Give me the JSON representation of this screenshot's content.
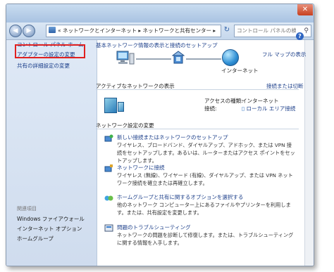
{
  "address": {
    "back_glyph": "◀",
    "forward_glyph": "▶",
    "icon": "control-panel-icon",
    "breadcrumb": "«  ネットワークとインターネット  ▸  ネットワークと共有センター  ▸",
    "refresh_glyph": "↻"
  },
  "search": {
    "placeholder": "コントロール パネルの検索",
    "icon_glyph": "⚲"
  },
  "window": {
    "close_glyph": "✕"
  },
  "sidebar": {
    "home": "コントロール パネル ホーム",
    "adapter_settings": "アダプターの設定の変更",
    "advanced_sharing": "共有の詳細設定の変更",
    "see_also_heading": "関連項目",
    "links": [
      "Windows ファイアウォール",
      "インターネット オプション",
      "ホームグループ"
    ]
  },
  "main": {
    "help_glyph": "?",
    "header_link": "基本ネットワーク情報の表示と接続のセットアップ",
    "full_map": "フル マップの表示",
    "internet_label": "インターネット",
    "active_title": "アクティブなネットワークの表示",
    "connect_disconnect": "接続または切断",
    "access_type_label": "アクセスの種類:",
    "access_type_value": "インターネット",
    "connection_label": "接続:",
    "connection_value": "ローカル エリア接続",
    "change_title": "ネットワーク設定の変更",
    "tasks": [
      {
        "icon": "new-connection-icon",
        "link": "新しい接続またはネットワークのセットアップ",
        "desc": "ワイヤレス、ブロードバンド、ダイヤルアップ、アドホック、または VPN 接続をセットアップします。あるいは、ルーターまたはアクセス ポイントをセットアップします。"
      },
      {
        "icon": "connect-network-icon",
        "link": "ネットワークに接続",
        "desc": "ワイヤレス (無線)、ワイヤード (有線)、ダイヤルアップ、または VPN ネットワーク接続を確立または再確立します。"
      },
      {
        "icon": "homegroup-icon",
        "link": "ホームグループと共有に関するオプションを選択する",
        "desc": "他のネットワーク コンピューター上にあるファイルやプリンターを利用します。または、共有設定を変更します。"
      },
      {
        "icon": "troubleshoot-icon",
        "link": "問題のトラブルシューティング",
        "desc": "ネットワークの問題を診断して修復します。または、トラブルシューティングに関する情報を入手します。"
      }
    ]
  },
  "colors": {
    "link": "#1c3f8a",
    "highlight_border": "#e02020",
    "sidebar_bg": "#dfe9f6"
  }
}
